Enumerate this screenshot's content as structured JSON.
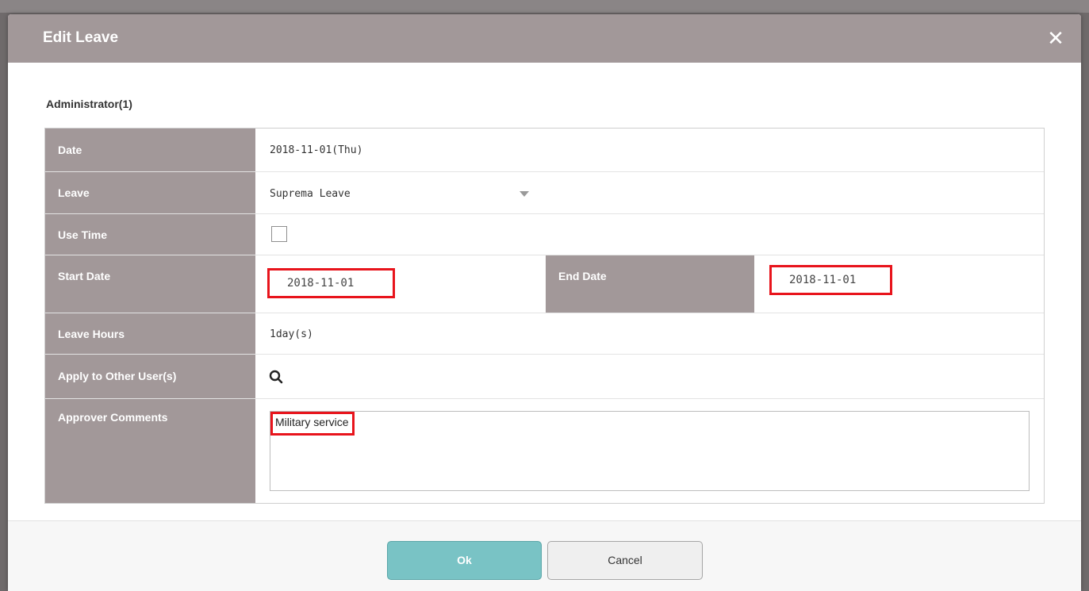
{
  "dialog": {
    "title": "Edit Leave",
    "close_icon": "close-icon"
  },
  "user": "Administrator(1)",
  "form": {
    "date": {
      "label": "Date",
      "value": "2018-11-01(Thu)"
    },
    "leave": {
      "label": "Leave",
      "value": "Suprema Leave",
      "arrow_icon": "chevron-down-icon"
    },
    "use_time": {
      "label": "Use Time",
      "checked": false
    },
    "start_date": {
      "label": "Start Date",
      "value": "2018-11-01"
    },
    "end_date": {
      "label": "End Date",
      "value": "2018-11-01"
    },
    "leave_hours": {
      "label": "Leave Hours",
      "value": "1day(s)"
    },
    "apply_to_other": {
      "label": "Apply to Other User(s)",
      "icon": "search-icon"
    },
    "approver_comments": {
      "label": "Approver Comments",
      "value": "Military service"
    }
  },
  "footer": {
    "ok_label": "Ok",
    "cancel_label": "Cancel"
  },
  "colors": {
    "header": "#a29899",
    "label_cell": "#a29899",
    "highlight": "#e8141c",
    "ok_button": "#79c3c5"
  }
}
